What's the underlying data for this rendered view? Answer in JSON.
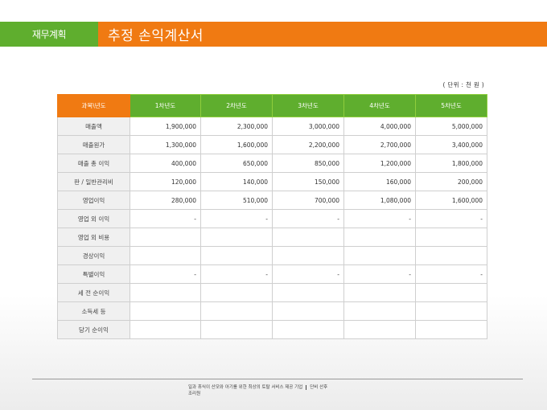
{
  "header": {
    "section_label": "재무계획",
    "title": "추정 손익계산서"
  },
  "unit_note": "( 단위 : 천 원 )",
  "table": {
    "columns": [
      "과목\\년도",
      "1차년도",
      "2차년도",
      "3차년도",
      "4차년도",
      "5차년도"
    ],
    "rows": [
      {
        "label": "매출액",
        "values": [
          "1,900,000",
          "2,300,000",
          "3,000,000",
          "4,000,000",
          "5,000,000"
        ]
      },
      {
        "label": "매출원가",
        "values": [
          "1,300,000",
          "1,600,000",
          "2,200,000",
          "2,700,000",
          "3,400,000"
        ]
      },
      {
        "label": "매출 총 이익",
        "values": [
          "400,000",
          "650,000",
          "850,000",
          "1,200,000",
          "1,800,000"
        ]
      },
      {
        "label": "판 / 일반관리비",
        "values": [
          "120,000",
          "140,000",
          "150,000",
          "160,000",
          "200,000"
        ]
      },
      {
        "label": "영업이익",
        "values": [
          "280,000",
          "510,000",
          "700,000",
          "1,080,000",
          "1,600,000"
        ]
      },
      {
        "label": "영업 외 이익",
        "values": [
          "-",
          "-",
          "-",
          "-",
          "-"
        ]
      },
      {
        "label": "영업 외 비용",
        "values": [
          "",
          "",
          "",
          "",
          ""
        ]
      },
      {
        "label": "경상이익",
        "values": [
          "",
          "",
          "",
          "",
          ""
        ]
      },
      {
        "label": "특별이익",
        "values": [
          "-",
          "-",
          "-",
          "-",
          "-"
        ]
      },
      {
        "label": "세 전 순이익",
        "values": [
          "",
          "",
          "",
          "",
          ""
        ]
      },
      {
        "label": "소득세 등",
        "values": [
          "",
          "",
          "",
          "",
          ""
        ]
      },
      {
        "label": "당기 순이익",
        "values": [
          "",
          "",
          "",
          "",
          ""
        ]
      }
    ]
  },
  "footer": {
    "line1_main": "일과 휴식이 산모와 아기를 위한 최상의 토탈 서비스 제공 기업",
    "line1_brand": "단비 산후",
    "line2": "조리원"
  },
  "colors": {
    "orange": "#f07a12",
    "green": "#5fae2e"
  }
}
